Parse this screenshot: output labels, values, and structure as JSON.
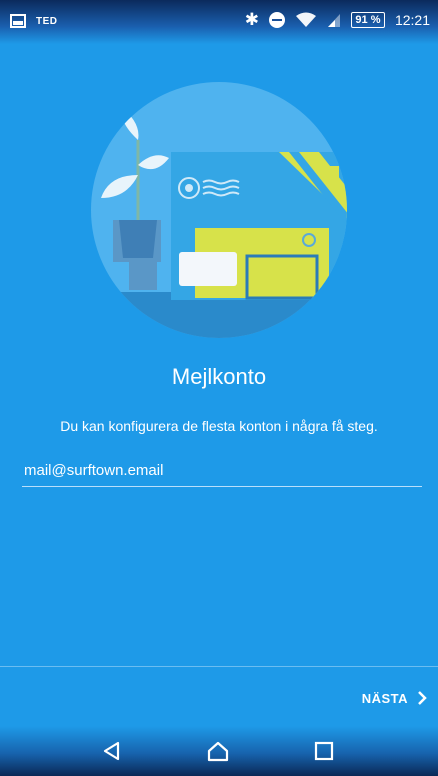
{
  "status_bar": {
    "carrier": "TED",
    "battery": "91 %",
    "time": "12:21",
    "icons": [
      "image-icon",
      "bluetooth-icon",
      "do-not-disturb-icon",
      "wifi-icon",
      "signal-icon",
      "battery-icon"
    ]
  },
  "screen": {
    "title": "Mejlkonto",
    "subtitle": "Du kan konfigurera de flesta konton i några få steg.",
    "email_value": "mail@surftown.email",
    "next_label": "NÄSTA"
  },
  "nav_bar": {
    "icons": [
      "back-icon",
      "home-icon",
      "recents-icon"
    ]
  },
  "colors": {
    "background": "#1e9ae8",
    "circle": "#4fb3ef",
    "accent_yellow": "#d7e24a",
    "text": "#ffffff"
  }
}
